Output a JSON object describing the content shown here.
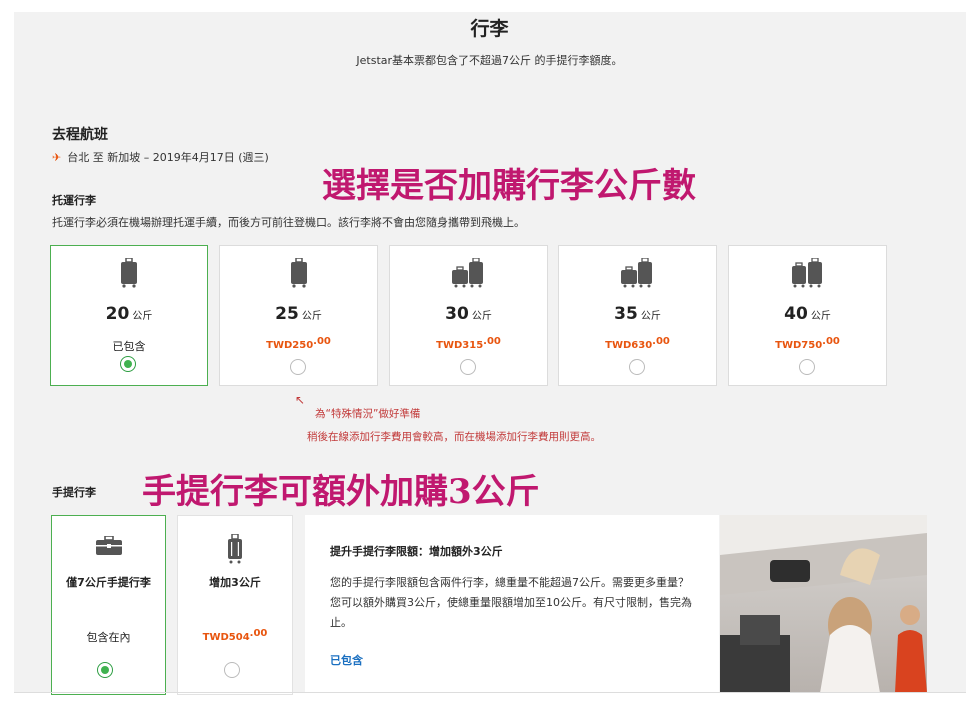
{
  "page": {
    "title": "行李",
    "subtitle": "Jetstar基本票都包含了不超過7公斤 的手提行李額度。"
  },
  "outbound": {
    "heading": "去程航班",
    "route": "台北 至 新加坡 – 2019年4月17日 (週三)",
    "overlay_text": "選擇是否加購行李公斤數"
  },
  "checked": {
    "heading": "托運行李",
    "description": "托運行李必須在機場辦理托運手續，而後方可前往登機口。該行李將不會由您隨身攜帶到飛機上。",
    "options": [
      {
        "weight": "20",
        "unit": "公斤",
        "included_label": "已包含",
        "icon": "suitcase-icon",
        "selected": true
      },
      {
        "weight": "25",
        "unit": "公斤",
        "currency": "TWD",
        "amount": "250",
        "cents": ".00",
        "icon": "suitcase-icon",
        "selected": false
      },
      {
        "weight": "30",
        "unit": "公斤",
        "currency": "TWD",
        "amount": "315",
        "cents": ".00",
        "icon": "luggage-pair-icon",
        "selected": false
      },
      {
        "weight": "35",
        "unit": "公斤",
        "currency": "TWD",
        "amount": "630",
        "cents": ".00",
        "icon": "luggage-pair-icon",
        "selected": false
      },
      {
        "weight": "40",
        "unit": "公斤",
        "currency": "TWD",
        "amount": "750",
        "cents": ".00",
        "icon": "luggage-pair-icon",
        "selected": false
      }
    ],
    "note_line1": "為“特殊情況”做好準備",
    "note_line2": "稍後在線添加行李費用會較高，而在機場添加行李費用則更高。"
  },
  "carry_on": {
    "heading": "手提行李",
    "overlay_text": "手提行李可額外加購3公斤",
    "option_included": {
      "label": "僅7公斤手提行李",
      "included_label": "包含在內",
      "icon": "briefcase-icon",
      "selected": true
    },
    "option_extra": {
      "label": "增加3公斤",
      "currency": "TWD",
      "amount": "504",
      "cents": ".00",
      "icon": "trolley-bag-icon",
      "selected": false
    },
    "info": {
      "title": "提升手提行李限額：增加額外3公斤",
      "body": "您的手提行李限額包含兩件行李，總重量不能超過7公斤。需要更多重量？ 您可以額外購買3公斤，使總重量限額增加至10公斤。有尺寸限制，售完為止。",
      "link": "已包含"
    }
  },
  "colors": {
    "accent": "#e8550f",
    "selected": "#4caf50",
    "overlay": "#c0186f",
    "link": "#1a6fc0"
  }
}
